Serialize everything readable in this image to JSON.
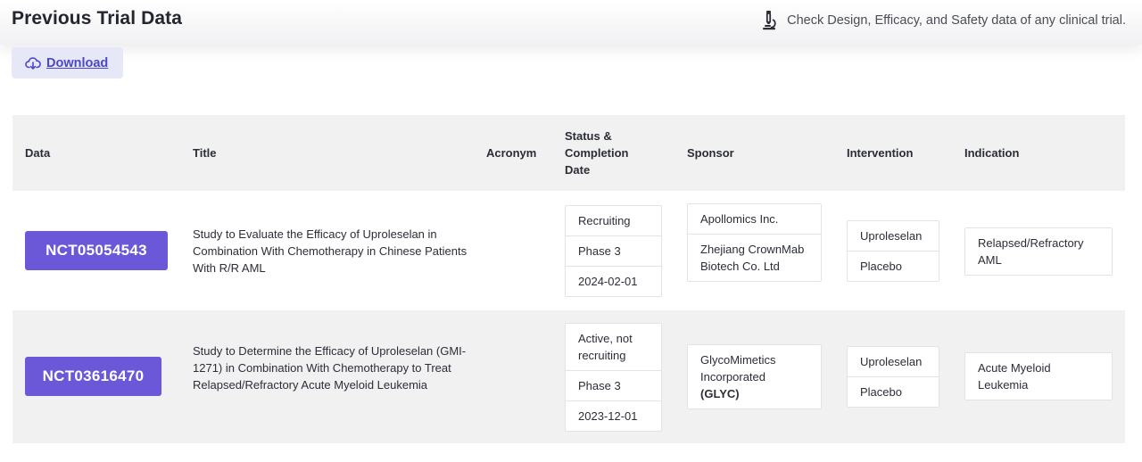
{
  "header": {
    "title": "Previous Trial Data",
    "subtitle": "Check Design, Efficacy, and Safety data of any clinical trial.",
    "subtitle_icon": "microscope-icon"
  },
  "toolbar": {
    "download_label": "Download",
    "download_icon": "cloud-download-icon"
  },
  "table": {
    "columns": {
      "data": "Data",
      "title": "Title",
      "acronym": "Acronym",
      "status_line1": "Status &",
      "status_line2": "Completion",
      "status_line3": "Date",
      "sponsor": "Sponsor",
      "intervention": "Intervention",
      "indication": "Indication"
    },
    "rows": [
      {
        "nct": "NCT05054543",
        "title": "Study to Evaluate the Efficacy of Uproleselan in Combination With Chemotherapy in Chinese Patients With R/R AML",
        "acronym": "",
        "status": "Recruiting",
        "phase": "Phase 3",
        "completion_date": "2024-02-01",
        "sponsors": [
          "Apollomics Inc.",
          "Zhejiang CrownMab Biotech Co. Ltd"
        ],
        "interventions": [
          "Uproleselan",
          "Placebo"
        ],
        "indication": "Relapsed/Refractory AML"
      },
      {
        "nct": "NCT03616470",
        "title": "Study to Determine the Efficacy of Uproleselan (GMI-1271) in Combination With Chemotherapy to Treat Relapsed/Refractory Acute Myeloid Leukemia",
        "acronym": "",
        "status": "Active, not recruiting",
        "phase": "Phase 3",
        "completion_date": "2023-12-01",
        "sponsor_name": "GlycoMimetics Incorporated",
        "sponsor_ticker": "(GLYC)",
        "interventions": [
          "Uproleselan",
          "Placebo"
        ],
        "indication": "Acute Myeloid Leukemia"
      }
    ]
  },
  "colors": {
    "accent": "#6b58d9",
    "download_bg": "#e6e8f8",
    "download_text": "#4b48c9",
    "row_alt_bg": "#f1f1f2"
  }
}
